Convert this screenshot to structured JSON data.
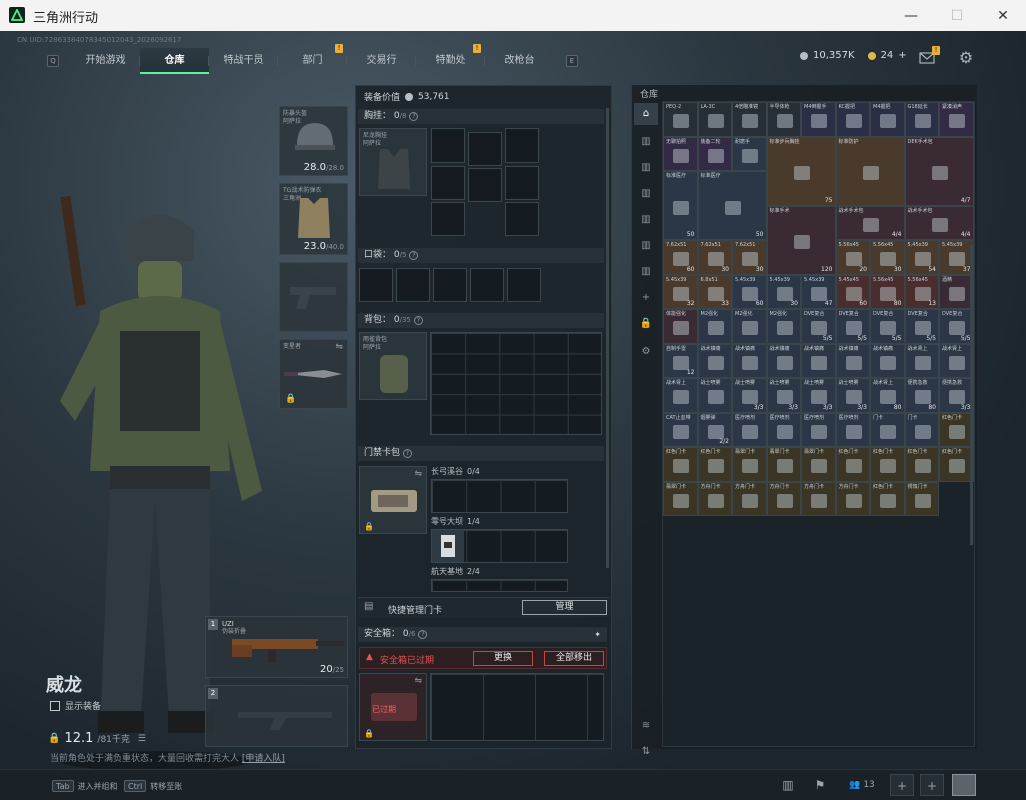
{
  "window": {
    "title": "三角洲行动",
    "minimize": "—",
    "maximize": "☐",
    "close": "✕"
  },
  "uid_text": "CN UID:72863384078345012043_2026092617",
  "nav": {
    "left_key": "Q",
    "right_key": "E",
    "tabs": [
      {
        "label": "开始游戏",
        "badge": ""
      },
      {
        "label": "仓库",
        "badge": "",
        "active": true
      },
      {
        "label": "特战干员",
        "badge": ""
      },
      {
        "label": "部门",
        "badge": "!"
      },
      {
        "label": "交易行",
        "badge": ""
      },
      {
        "label": "特勤处",
        "badge": "!"
      },
      {
        "label": "改枪台",
        "badge": ""
      }
    ]
  },
  "currency": {
    "coins": "10,357K",
    "tickets": "24",
    "plus": "+",
    "mail_badge": "!"
  },
  "character": {
    "name": "威龙",
    "show_gear_label": "显示装备",
    "weight": "12.1",
    "weight_max": "/81千克",
    "tip_text": "当前角色处于满负重状态，大量回收需打完大人",
    "tip_link": "[申请入队]"
  },
  "gear_slots": {
    "helmet": {
      "name": "防暴头盔\n阿萨拉",
      "dur": "28.0",
      "max": "/28.0"
    },
    "armor": {
      "name": "TG战术防弹衣\n三角洲",
      "dur": "23.0",
      "max": "/40.0"
    },
    "melee": {
      "name": "变星者"
    },
    "primary": {
      "index": "1",
      "name": "UZI",
      "sub": "伪装折叠",
      "ammo": "20",
      "ammo_max": "/25"
    },
    "secondary": {
      "index": "2"
    }
  },
  "middle": {
    "value_label": "装备价值",
    "value": "53,761",
    "chest": {
      "label": "胸挂",
      "count": "0",
      "max": "/8",
      "item": "尼龙胸挂\n阿萨拉"
    },
    "pocket": {
      "label": "口袋",
      "count": "0",
      "max": "/5"
    },
    "backpack": {
      "label": "背包",
      "count": "0",
      "max": "/35",
      "item": "雨雀背包\n阿萨拉"
    },
    "keycard": {
      "label": "门禁卡包",
      "rows": [
        {
          "name": "长弓溪谷",
          "count": "0/4"
        },
        {
          "name": "零号大坝",
          "count": "1/4"
        },
        {
          "name": "航天基地",
          "count": "2/4"
        }
      ]
    },
    "quick_manage": {
      "label": "快捷管理门卡",
      "button": "管理"
    },
    "safebox": {
      "label": "安全箱",
      "count": "0",
      "max": "/6",
      "expired_notice": "安全箱已过期",
      "replace": "更换",
      "move_all": "全部移出",
      "expired_tag": "已过期"
    }
  },
  "warehouse": {
    "title": "仓库",
    "items": [
      {
        "nm": "PEQ-2",
        "ct": "",
        "c": "#262f36"
      },
      {
        "nm": "LA-3C",
        "ct": "",
        "c": "#262f36"
      },
      {
        "nm": "4倍瞄准镜",
        "ct": "",
        "c": "#262f36"
      },
      {
        "nm": "半导体枪",
        "ct": "",
        "c": "#262f36"
      },
      {
        "nm": "M4倒握手",
        "ct": "",
        "c": "#2a2f45"
      },
      {
        "nm": "KC握把",
        "ct": "",
        "c": "#2a2f45"
      },
      {
        "nm": "M4握把",
        "ct": "",
        "c": "#2a2f45"
      },
      {
        "nm": "G18延长",
        "ct": "",
        "c": "#2a2f45"
      },
      {
        "nm": "紧凑消声",
        "ct": "",
        "c": "#332b45"
      },
      {
        "nm": "无聊拍照",
        "ct": "",
        "c": "#332b45"
      },
      {
        "nm": "装备二轮",
        "ct": "",
        "c": "#332b45"
      },
      {
        "nm": "耐磨手",
        "ct": "",
        "c": "#2b3647"
      },
      {
        "nm": "标准步兵胸挂",
        "ct": "75",
        "c": "#4a3a2c"
      },
      {
        "nm": "标准防护",
        "ct": "",
        "c": "#4a3a2c"
      },
      {
        "nm": "DEK手术包",
        "ct": "4/7",
        "c": "#3a2a34"
      },
      {
        "nm": "标准医疗",
        "ct": "50",
        "c": "#2b3647"
      },
      {
        "nm": "标准医疗",
        "ct": "50",
        "c": "#2b3647"
      },
      {
        "nm": "标准手术",
        "ct": "120",
        "c": "#3a2a34"
      },
      {
        "nm": "战术手术包",
        "ct": "4/4",
        "c": "#3a2a34"
      },
      {
        "nm": "战术手术包",
        "ct": "4/4",
        "c": "#3a2a34"
      },
      {
        "nm": "7.62x51",
        "ct": "60",
        "c": "#4a3a2c"
      },
      {
        "nm": "7.62x51",
        "ct": "30",
        "c": "#4a3a2c"
      },
      {
        "nm": "7.62x51",
        "ct": "30",
        "c": "#4a3a2c"
      },
      {
        "nm": "5.56x45",
        "ct": "20",
        "c": "#4a3a2c"
      },
      {
        "nm": "5.56x45",
        "ct": "30",
        "c": "#4a3a2c"
      },
      {
        "nm": "5.45x39",
        "ct": "54",
        "c": "#4a3a2c"
      },
      {
        "nm": "5.45x39",
        "ct": "37",
        "c": "#4a3a2c"
      },
      {
        "nm": "5.45x39",
        "ct": "32",
        "c": "#4a3a2c"
      },
      {
        "nm": "6.8x51",
        "ct": "33",
        "c": "#4a3a2c"
      },
      {
        "nm": "5.45x39",
        "ct": "60",
        "c": "#2b3647"
      },
      {
        "nm": "5.45x39",
        "ct": "30",
        "c": "#2b3647"
      },
      {
        "nm": "5.45x39",
        "ct": "47",
        "c": "#2b3647"
      },
      {
        "nm": "5.45x45",
        "ct": "60",
        "c": "#4a2e2e"
      },
      {
        "nm": "5.56x45",
        "ct": "80",
        "c": "#4a2e2e"
      },
      {
        "nm": "5.56x45",
        "ct": "13",
        "c": "#4a2e2e"
      },
      {
        "nm": "酒精",
        "ct": "",
        "c": "#3a2a34"
      },
      {
        "nm": "体能强化",
        "ct": "",
        "c": "#3a2a34"
      },
      {
        "nm": "M2强化",
        "ct": "",
        "c": "#2b3647"
      },
      {
        "nm": "M2强化",
        "ct": "",
        "c": "#2b3647"
      },
      {
        "nm": "M2强化",
        "ct": "",
        "c": "#2b3647"
      },
      {
        "nm": "DVE复合",
        "ct": "5/5",
        "c": "#2b3647"
      },
      {
        "nm": "DVE复合",
        "ct": "5/5",
        "c": "#2b3647"
      },
      {
        "nm": "DVE复合",
        "ct": "5/5",
        "c": "#2b3647"
      },
      {
        "nm": "DVE复合",
        "ct": "5/5",
        "c": "#2b3647"
      },
      {
        "nm": "DVE复合",
        "ct": "5/5",
        "c": "#2b3647"
      },
      {
        "nm": "自制手雷",
        "ct": "12",
        "c": "#2b3647"
      },
      {
        "nm": "战术镇痛",
        "ct": "",
        "c": "#2b3647"
      },
      {
        "nm": "战术镇痛",
        "ct": "",
        "c": "#2b3647"
      },
      {
        "nm": "战术镇痛",
        "ct": "",
        "c": "#2b3647"
      },
      {
        "nm": "战术镇痛",
        "ct": "",
        "c": "#2b3647"
      },
      {
        "nm": "战术镇痛",
        "ct": "",
        "c": "#2b3647"
      },
      {
        "nm": "战术镇痛",
        "ct": "",
        "c": "#2b3647"
      },
      {
        "nm": "战术肾上",
        "ct": "",
        "c": "#2b3647"
      },
      {
        "nm": "战术肾上",
        "ct": "",
        "c": "#2b3647"
      },
      {
        "nm": "战术肾上",
        "ct": "",
        "c": "#2b3647"
      },
      {
        "nm": "战士喷雾",
        "ct": "",
        "c": "#2b3647"
      },
      {
        "nm": "战士喷雾",
        "ct": "3/3",
        "c": "#2b3647"
      },
      {
        "nm": "战士喷雾",
        "ct": "3/3",
        "c": "#2b3647"
      },
      {
        "nm": "战士喷雾",
        "ct": "3/3",
        "c": "#2b3647"
      },
      {
        "nm": "战士喷雾",
        "ct": "3/3",
        "c": "#2b3647"
      },
      {
        "nm": "战术肾上",
        "ct": "80",
        "c": "#2b3647"
      },
      {
        "nm": "便携急救",
        "ct": "80",
        "c": "#2b3647"
      },
      {
        "nm": "便携急救",
        "ct": "3/3",
        "c": "#2b3647"
      },
      {
        "nm": "CAT止血带",
        "ct": "",
        "c": "#2b3647"
      },
      {
        "nm": "烟雾弹",
        "ct": "2/2",
        "c": "#2b3647"
      },
      {
        "nm": "医疗喷剂",
        "ct": "",
        "c": "#2b3647"
      },
      {
        "nm": "医疗喷剂",
        "ct": "",
        "c": "#2b3647"
      },
      {
        "nm": "医疗喷剂",
        "ct": "",
        "c": "#2b3647"
      },
      {
        "nm": "医疗喷剂",
        "ct": "",
        "c": "#2b3647"
      },
      {
        "nm": "门卡",
        "ct": "",
        "c": "#2b3647"
      },
      {
        "nm": "门卡",
        "ct": "",
        "c": "#2b3647"
      },
      {
        "nm": "红色门卡",
        "ct": "",
        "c": "#3a3524"
      },
      {
        "nm": "红色门卡",
        "ct": "",
        "c": "#3a3524"
      },
      {
        "nm": "红色门卡",
        "ct": "",
        "c": "#3a3524"
      },
      {
        "nm": "翡翠门卡",
        "ct": "",
        "c": "#3a3524"
      },
      {
        "nm": "翡翠门卡",
        "ct": "",
        "c": "#3a3524"
      },
      {
        "nm": "翡翠门卡",
        "ct": "",
        "c": "#3a3524"
      },
      {
        "nm": "红色门卡",
        "ct": "",
        "c": "#3a3524"
      },
      {
        "nm": "红色门卡",
        "ct": "",
        "c": "#3a3524"
      },
      {
        "nm": "红色门卡",
        "ct": "",
        "c": "#3a3524"
      },
      {
        "nm": "红色门卡",
        "ct": "",
        "c": "#3a3524"
      },
      {
        "nm": "翡翠门卡",
        "ct": "",
        "c": "#3a3524"
      },
      {
        "nm": "方舟门卡",
        "ct": "",
        "c": "#3a3524"
      },
      {
        "nm": "方舟门卡",
        "ct": "",
        "c": "#3a3524"
      },
      {
        "nm": "方舟门卡",
        "ct": "",
        "c": "#3a3524"
      },
      {
        "nm": "方舟门卡",
        "ct": "",
        "c": "#3a3524"
      },
      {
        "nm": "方舟门卡",
        "ct": "",
        "c": "#3a3524"
      },
      {
        "nm": "红色门卡",
        "ct": "",
        "c": "#3a3524"
      },
      {
        "nm": "锈蚀门卡",
        "ct": "",
        "c": "#3a3524"
      }
    ]
  },
  "footer": {
    "tab_key": "Tab",
    "tab_label": "进入并组和",
    "ctrl_key": "Ctrl",
    "ctrl_label": "转移至账",
    "friends": "13",
    "plus": "+"
  }
}
